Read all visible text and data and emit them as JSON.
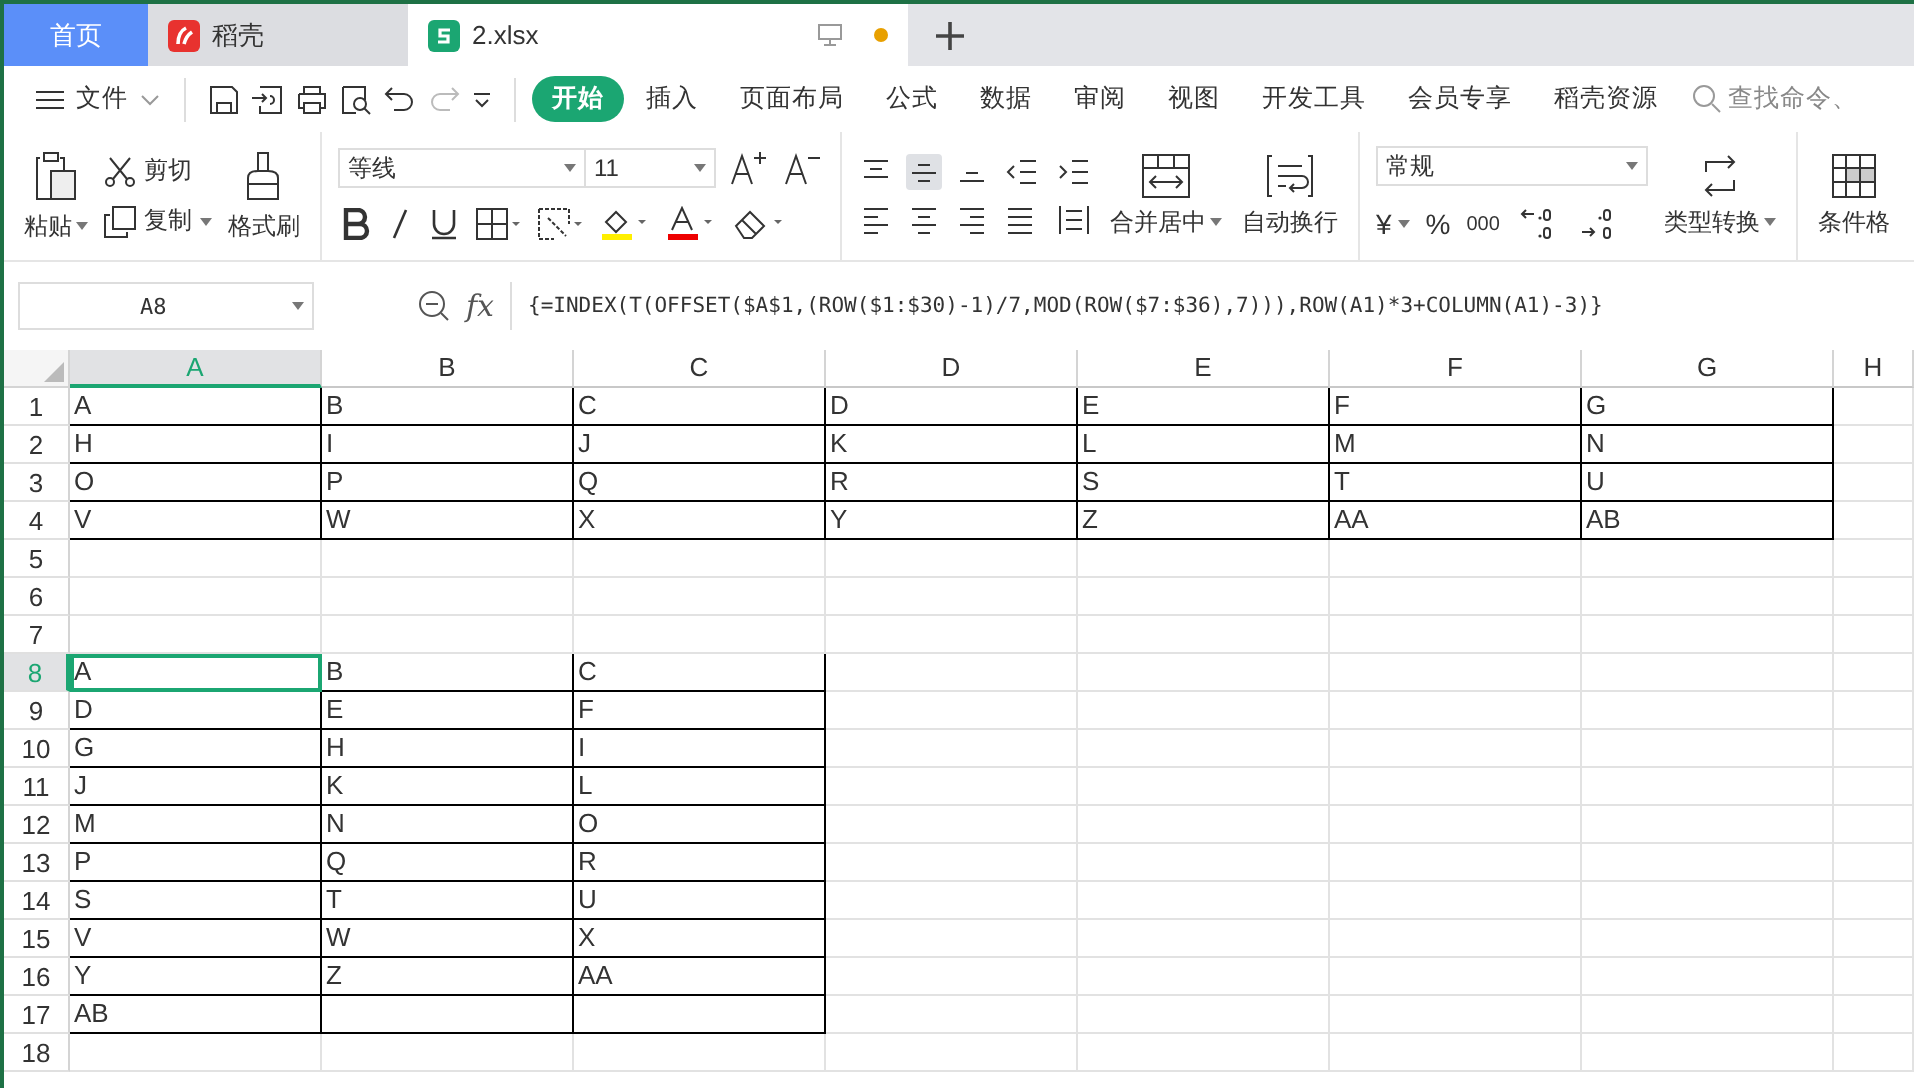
{
  "tabs": [
    {
      "label": "首页",
      "kind": "home",
      "selected": false
    },
    {
      "label": "稻壳",
      "kind": "docer",
      "selected": false
    },
    {
      "label": "2.xlsx",
      "kind": "sheet",
      "selected": true,
      "unsaved": true
    }
  ],
  "menu": {
    "file": "文件",
    "items": [
      {
        "label": "开始",
        "selected": true
      },
      {
        "label": "插入",
        "selected": false
      },
      {
        "label": "页面布局",
        "selected": false
      },
      {
        "label": "公式",
        "selected": false
      },
      {
        "label": "数据",
        "selected": false
      },
      {
        "label": "审阅",
        "selected": false
      },
      {
        "label": "视图",
        "selected": false
      },
      {
        "label": "开发工具",
        "selected": false
      },
      {
        "label": "会员专享",
        "selected": false
      },
      {
        "label": "稻壳资源",
        "selected": false
      }
    ],
    "search": "查找命令、"
  },
  "ribbon": {
    "paste": "粘贴",
    "cut": "剪切",
    "copy": "复制",
    "format_painter": "格式刷",
    "font": "等线",
    "font_size": "11",
    "merge": "合并居中",
    "wrap": "自动换行",
    "number_format": "常规",
    "currency": "¥",
    "percent": "%",
    "thousands": "000",
    "type_convert": "类型转换",
    "conditional": "条件格"
  },
  "formula_bar": {
    "name_box": "A8",
    "fx": "fx",
    "formula": "{=INDEX(T(OFFSET($A$1,(ROW($1:$30)-1)/7,MOD(ROW($7:$36),7))),ROW(A1)*3+COLUMN(A1)-3)}"
  },
  "sheet": {
    "columns": [
      {
        "label": "A",
        "selected": true
      },
      {
        "label": "B",
        "selected": false
      },
      {
        "label": "C",
        "selected": false
      },
      {
        "label": "D",
        "selected": false
      },
      {
        "label": "E",
        "selected": false
      },
      {
        "label": "F",
        "selected": false
      },
      {
        "label": "G",
        "selected": false
      },
      {
        "label": "H",
        "selected": false
      }
    ],
    "rows": [
      {
        "label": "1",
        "selected": false,
        "cells": [
          {
            "text": "A",
            "bordered": true
          },
          {
            "text": "B",
            "bordered": true
          },
          {
            "text": "C",
            "bordered": true
          },
          {
            "text": "D",
            "bordered": true
          },
          {
            "text": "E",
            "bordered": true
          },
          {
            "text": "F",
            "bordered": true
          },
          {
            "text": "G",
            "bordered": true
          }
        ]
      },
      {
        "label": "2",
        "selected": false,
        "cells": [
          {
            "text": "H",
            "bordered": true
          },
          {
            "text": "I",
            "bordered": true
          },
          {
            "text": "J",
            "bordered": true
          },
          {
            "text": "K",
            "bordered": true
          },
          {
            "text": "L",
            "bordered": true
          },
          {
            "text": "M",
            "bordered": true
          },
          {
            "text": "N",
            "bordered": true
          }
        ]
      },
      {
        "label": "3",
        "selected": false,
        "cells": [
          {
            "text": "O",
            "bordered": true
          },
          {
            "text": "P",
            "bordered": true
          },
          {
            "text": "Q",
            "bordered": true
          },
          {
            "text": "R",
            "bordered": true
          },
          {
            "text": "S",
            "bordered": true
          },
          {
            "text": "T",
            "bordered": true
          },
          {
            "text": "U",
            "bordered": true
          }
        ]
      },
      {
        "label": "4",
        "selected": false,
        "cells": [
          {
            "text": "V",
            "bordered": true
          },
          {
            "text": "W",
            "bordered": true
          },
          {
            "text": "X",
            "bordered": true
          },
          {
            "text": "Y",
            "bordered": true
          },
          {
            "text": "Z",
            "bordered": true
          },
          {
            "text": "AA",
            "bordered": true
          },
          {
            "text": "AB",
            "bordered": true
          }
        ]
      },
      {
        "label": "5",
        "selected": false,
        "cells": []
      },
      {
        "label": "6",
        "selected": false,
        "cells": []
      },
      {
        "label": "7",
        "selected": false,
        "cells": []
      },
      {
        "label": "8",
        "selected": true,
        "cells": [
          {
            "text": "A",
            "bordered": true,
            "selected": true
          },
          {
            "text": "B",
            "bordered": true,
            "selected": false
          },
          {
            "text": "C",
            "bordered": true,
            "selected": false
          }
        ]
      },
      {
        "label": "9",
        "selected": false,
        "cells": [
          {
            "text": "D",
            "bordered": true
          },
          {
            "text": "E",
            "bordered": true
          },
          {
            "text": "F",
            "bordered": true
          }
        ]
      },
      {
        "label": "10",
        "selected": false,
        "cells": [
          {
            "text": "G",
            "bordered": true
          },
          {
            "text": "H",
            "bordered": true
          },
          {
            "text": "I",
            "bordered": true
          }
        ]
      },
      {
        "label": "11",
        "selected": false,
        "cells": [
          {
            "text": "J",
            "bordered": true
          },
          {
            "text": "K",
            "bordered": true
          },
          {
            "text": "L",
            "bordered": true
          }
        ]
      },
      {
        "label": "12",
        "selected": false,
        "cells": [
          {
            "text": "M",
            "bordered": true
          },
          {
            "text": "N",
            "bordered": true
          },
          {
            "text": "O",
            "bordered": true
          }
        ]
      },
      {
        "label": "13",
        "selected": false,
        "cells": [
          {
            "text": "P",
            "bordered": true
          },
          {
            "text": "Q",
            "bordered": true
          },
          {
            "text": "R",
            "bordered": true
          }
        ]
      },
      {
        "label": "14",
        "selected": false,
        "cells": [
          {
            "text": "S",
            "bordered": true
          },
          {
            "text": "T",
            "bordered": true
          },
          {
            "text": "U",
            "bordered": true
          }
        ]
      },
      {
        "label": "15",
        "selected": false,
        "cells": [
          {
            "text": "V",
            "bordered": true
          },
          {
            "text": "W",
            "bordered": true
          },
          {
            "text": "X",
            "bordered": true
          }
        ]
      },
      {
        "label": "16",
        "selected": false,
        "cells": [
          {
            "text": "Y",
            "bordered": true
          },
          {
            "text": "Z",
            "bordered": true
          },
          {
            "text": "AA",
            "bordered": true
          }
        ]
      },
      {
        "label": "17",
        "selected": false,
        "cells": [
          {
            "text": "AB",
            "bordered": true
          },
          {
            "bordered": true
          },
          {
            "bordered": true
          }
        ]
      },
      {
        "label": "18",
        "selected": false,
        "cells": []
      }
    ]
  }
}
